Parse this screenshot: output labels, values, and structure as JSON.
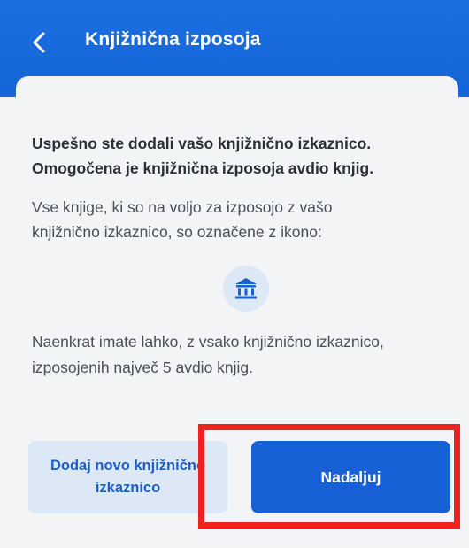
{
  "header": {
    "title": "Knjižnična izposoja",
    "back_icon": "chevron-left-icon"
  },
  "content": {
    "success_line1": "Uspešno ste dodali vašo knjižnično izkaznico.",
    "success_line2": "Omogočena je knjižnična izposoja avdio knjig.",
    "info_line1": "Vse knjige, ki so na voljo za izposojo z vašo",
    "info_line2": "knjižnično izkaznico, so označene z ikono:",
    "info_icon": "library-icon",
    "limit_line1": "Naenkrat imate lahko, z vsako knjižnično izkaznico,",
    "limit_line2": "izposojenih največ 5 avdio knjig."
  },
  "actions": {
    "add_card_line1": "Dodaj novo knjižnično",
    "add_card_line2": "izkaznico",
    "continue_label": "Nadaljuj"
  },
  "colors": {
    "header": "#1565d8",
    "primary_button": "#1860d6",
    "secondary_button": "#dde8f6",
    "highlight": "#ee2020"
  }
}
